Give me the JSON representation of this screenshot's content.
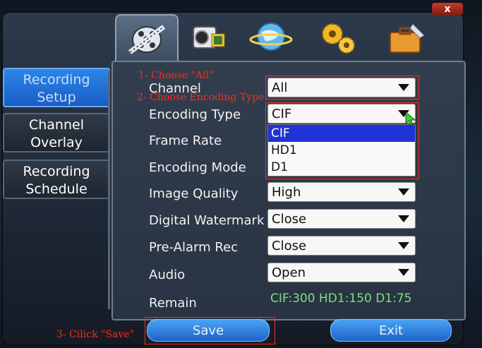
{
  "window": {
    "close_label": "x"
  },
  "tabs": [
    {
      "icon": "film-reel-icon",
      "active": true
    },
    {
      "icon": "camera-icon",
      "active": false
    },
    {
      "icon": "globe-icon",
      "active": false
    },
    {
      "icon": "gears-icon",
      "active": false
    },
    {
      "icon": "toolbox-icon",
      "active": false
    }
  ],
  "sidebar": {
    "items": [
      {
        "line1": "Recording",
        "line2": "Setup",
        "active": true
      },
      {
        "line1": "Channel",
        "line2": "Overlay",
        "active": false
      },
      {
        "line1": "Recording",
        "line2": "Schedule",
        "active": false
      }
    ]
  },
  "form": {
    "channel": {
      "label": "Channel",
      "value": "All"
    },
    "encoding_type": {
      "label": "Encoding Type",
      "value": "CIF",
      "options": [
        "CIF",
        "HD1",
        "D1"
      ],
      "selected_option": "CIF"
    },
    "frame_rate": {
      "label": "Frame Rate"
    },
    "encoding_mode": {
      "label": "Encoding Mode"
    },
    "image_quality": {
      "label": "Image Quality",
      "value": "High"
    },
    "digital_watermark": {
      "label": "Digital Watermark",
      "value": "Close"
    },
    "pre_alarm_rec": {
      "label": "Pre-Alarm Rec",
      "value": "Close"
    },
    "audio": {
      "label": "Audio",
      "value": "Open"
    },
    "remain": {
      "label": "Remain",
      "value": "CIF:300 HD1:150 D1:75"
    }
  },
  "buttons": {
    "save": "Save",
    "exit": "Exit"
  },
  "annotations": {
    "step1": "1- Choose \"All\"",
    "step2": "2- Choose Encoding Type",
    "step3": "3- Cilick \"Save\""
  },
  "colors": {
    "active_blue": "#2b86e8",
    "annotation_red": "#ff2a1a",
    "remain_green": "#7ee07a",
    "selected_option": "#1f33d6"
  }
}
